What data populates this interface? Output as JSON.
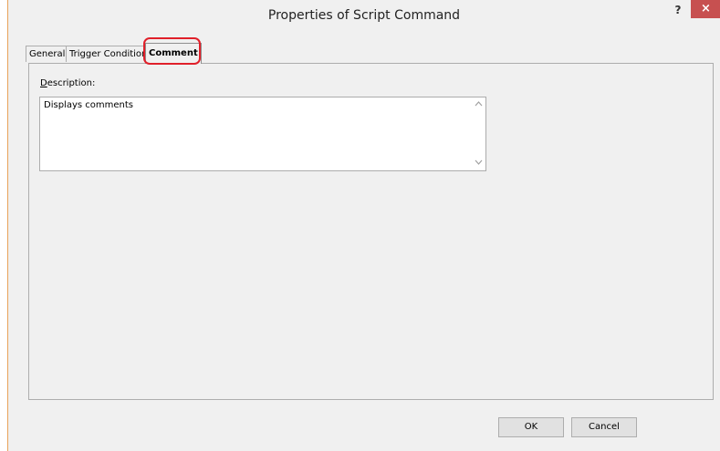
{
  "window": {
    "title": "Properties of Script Command",
    "help_label": "?",
    "close_label": "×"
  },
  "tabs": [
    {
      "label": "General",
      "active": false
    },
    {
      "label": "Trigger Condition",
      "active": false
    },
    {
      "label": "Comment",
      "active": true
    }
  ],
  "comment": {
    "description_label_underlined": "D",
    "description_label_rest": "escription:",
    "description_value": "Displays comments"
  },
  "scrollbar": {
    "up_icon": "chevron-up-icon",
    "down_icon": "chevron-down-icon"
  },
  "buttons": {
    "ok": "OK",
    "cancel": "Cancel"
  },
  "colors": {
    "close_button": "#c75050",
    "highlight": "#e0202a",
    "background": "#f0f0f0"
  }
}
